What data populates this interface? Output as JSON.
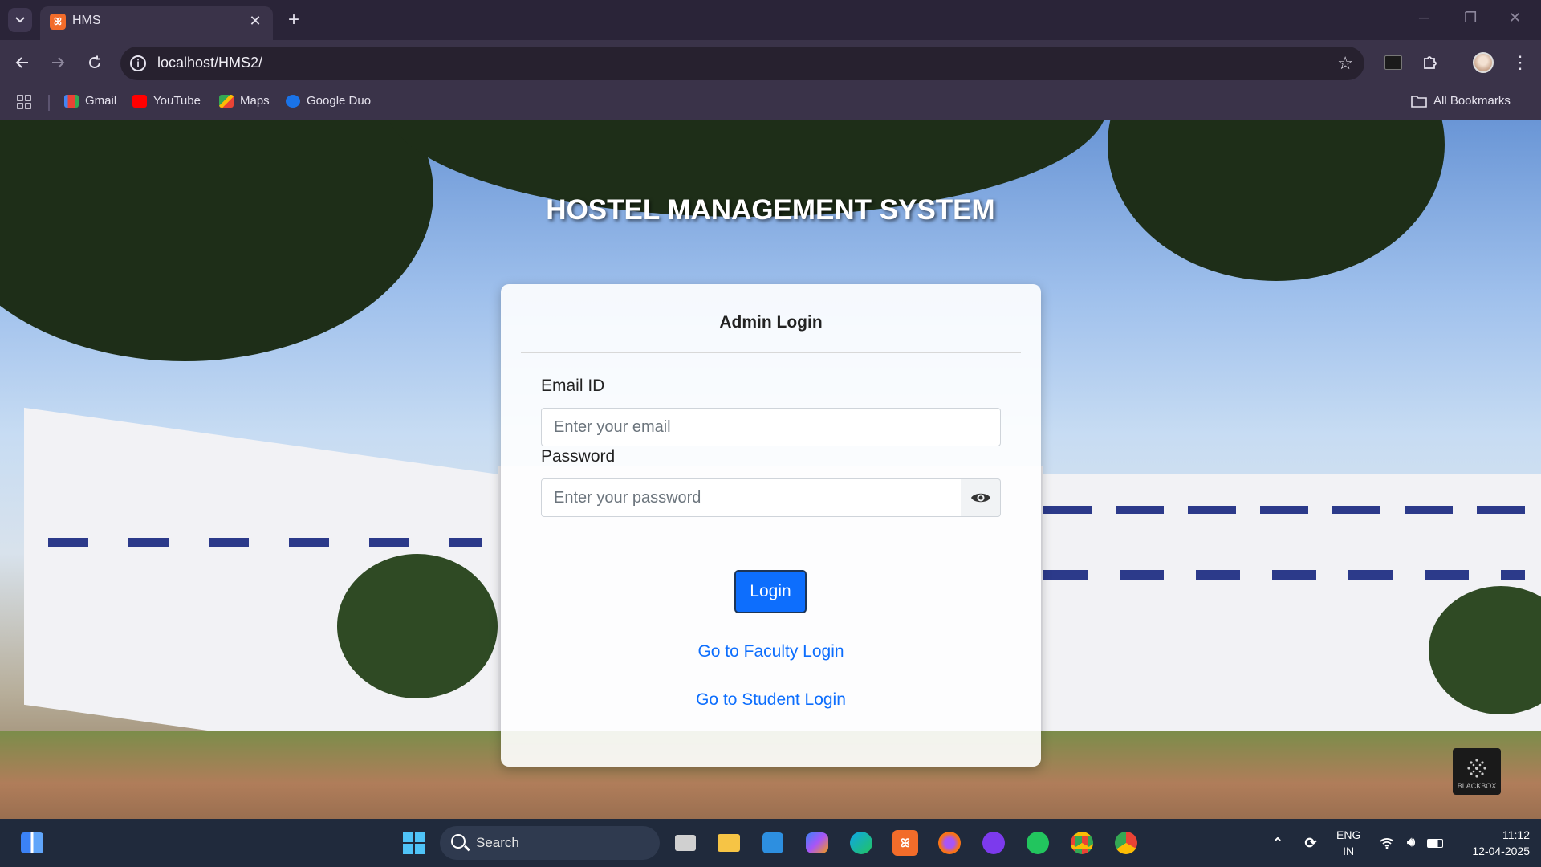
{
  "browser": {
    "tab_title": "HMS",
    "url": "localhost/HMS2/",
    "bookmarks": [
      {
        "label": "Gmail",
        "icon": "gmail-icon",
        "color": "#ea4335"
      },
      {
        "label": "YouTube",
        "icon": "youtube-icon",
        "color": "#ff0000"
      },
      {
        "label": "Maps",
        "icon": "maps-icon",
        "color": "#34a853"
      },
      {
        "label": "Google Duo",
        "icon": "duo-icon",
        "color": "#1a73e8"
      }
    ],
    "all_bookmarks": "All Bookmarks"
  },
  "page": {
    "title": "HOSTEL MANAGEMENT SYSTEM",
    "card": {
      "heading": "Admin Login",
      "email_label": "Email ID",
      "email_placeholder": "Enter your email",
      "password_label": "Password",
      "password_placeholder": "Enter your password",
      "login_button": "Login",
      "faculty_link": "Go to Faculty Login",
      "student_link": "Go to Student Login"
    },
    "watermark": "BLACKBOX"
  },
  "taskbar": {
    "search_label": "Search",
    "language": "ENG",
    "region": "IN",
    "time": "11:12",
    "date": "12-04-2025"
  },
  "colors": {
    "accent": "#0d6efd",
    "chrome_bg": "#3a3349",
    "taskbar_bg": "#202a3c"
  }
}
